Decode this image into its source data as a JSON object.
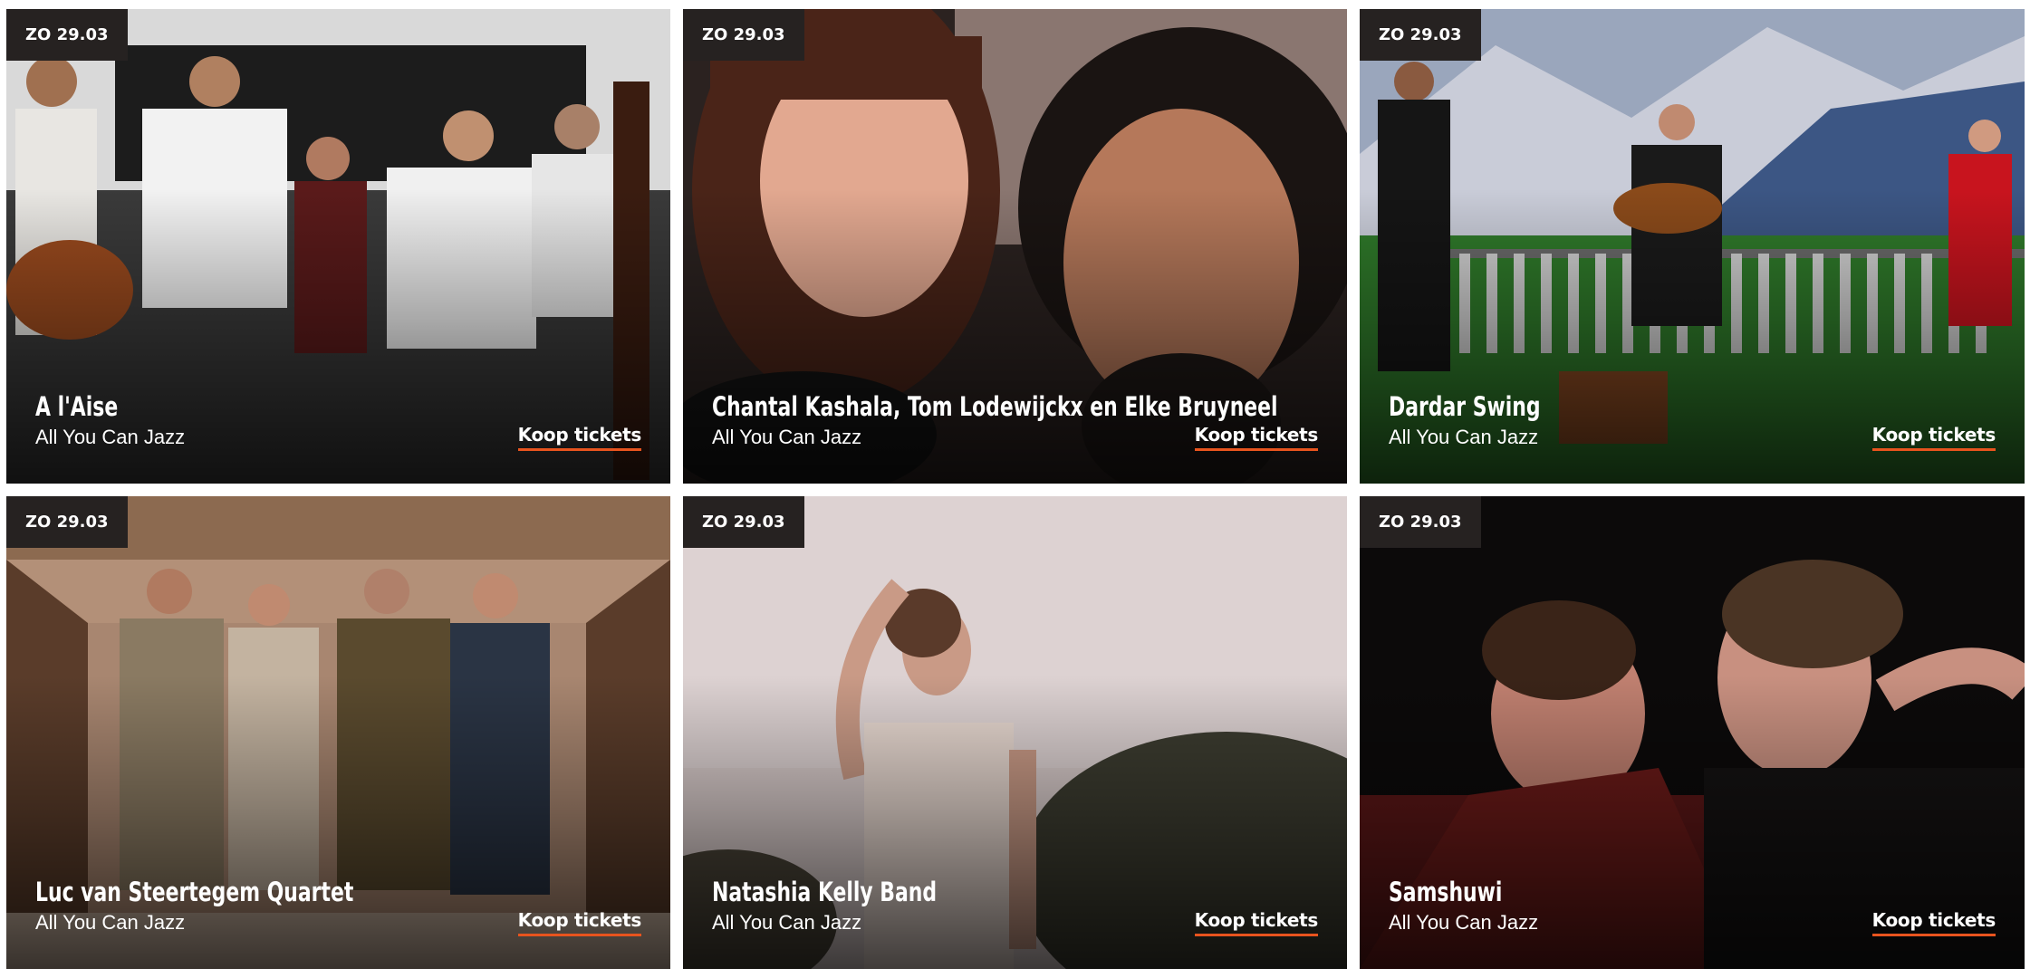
{
  "accent_color": "#e8541e",
  "events": [
    {
      "date": "ZO 29.03",
      "title": "A l'Aise",
      "series": "All You Can Jazz",
      "cta": "Koop tickets"
    },
    {
      "date": "ZO 29.03",
      "title": "Chantal Kashala, Tom Lodewijckx en Elke Bruyneel",
      "series": "All You Can Jazz",
      "cta": "Koop tickets"
    },
    {
      "date": "ZO 29.03",
      "title": "Dardar Swing",
      "series": "All You Can Jazz",
      "cta": "Koop tickets"
    },
    {
      "date": "ZO 29.03",
      "title": "Luc van Steertegem Quartet",
      "series": "All You Can Jazz",
      "cta": "Koop tickets"
    },
    {
      "date": "ZO 29.03",
      "title": "Natashia Kelly Band",
      "series": "All You Can Jazz",
      "cta": "Koop tickets"
    },
    {
      "date": "ZO 29.03",
      "title": "Samshuwi",
      "series": "All You Can Jazz",
      "cta": "Koop tickets"
    }
  ]
}
